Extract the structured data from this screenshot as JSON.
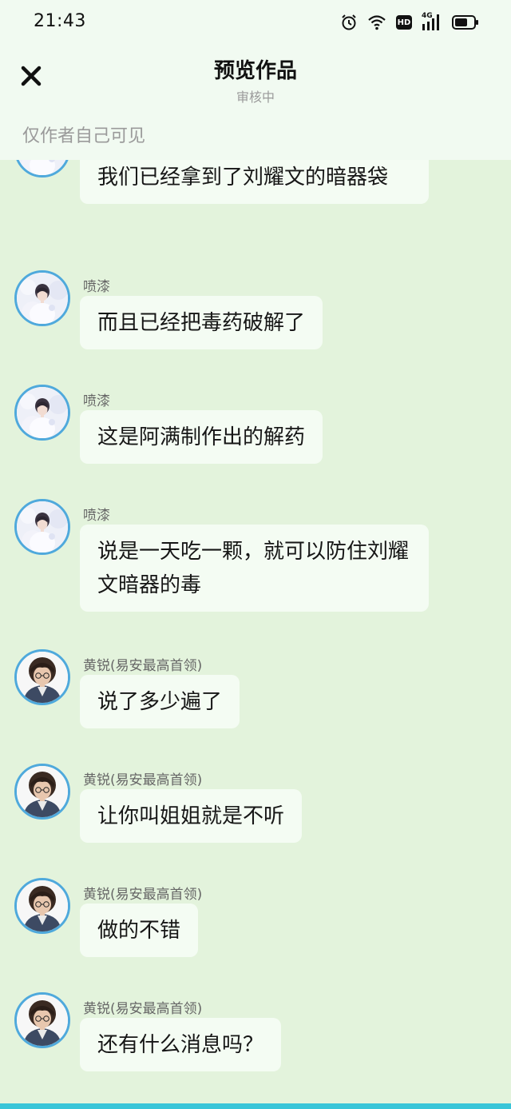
{
  "status": {
    "time": "21:43",
    "hd_label": "HD",
    "network_label": "4G"
  },
  "header": {
    "title": "预览作品",
    "subtitle": "审核中",
    "close_icon": "close-icon"
  },
  "visibility_note": "仅作者自己可见",
  "colors": {
    "background": "#e3f3dc",
    "bubble": "#f4fcf3",
    "avatar_ring": "#4fa9dc",
    "bottom_strip": "#39c5d8"
  },
  "messages": [
    {
      "sender": "",
      "text": "我们已经拿到了刘耀文的暗器袋",
      "avatar": "girl-avatar"
    },
    {
      "sender": "喷漆",
      "text": "而且已经把毒药破解了",
      "avatar": "girl-avatar"
    },
    {
      "sender": "喷漆",
      "text": "这是阿满制作出的解药",
      "avatar": "girl-avatar"
    },
    {
      "sender": "喷漆",
      "text": "说是一天吃一颗，就可以防住刘耀文暗器的毒",
      "avatar": "girl-avatar"
    },
    {
      "sender": "黄锐(易安最高首领)",
      "text": "说了多少遍了",
      "avatar": "boy-avatar"
    },
    {
      "sender": "黄锐(易安最高首领)",
      "text": "让你叫姐姐就是不听",
      "avatar": "boy-avatar"
    },
    {
      "sender": "黄锐(易安最高首领)",
      "text": "做的不错",
      "avatar": "boy-avatar"
    },
    {
      "sender": "黄锐(易安最高首领)",
      "text": "还有什么消息吗？",
      "avatar": "boy-avatar"
    }
  ]
}
